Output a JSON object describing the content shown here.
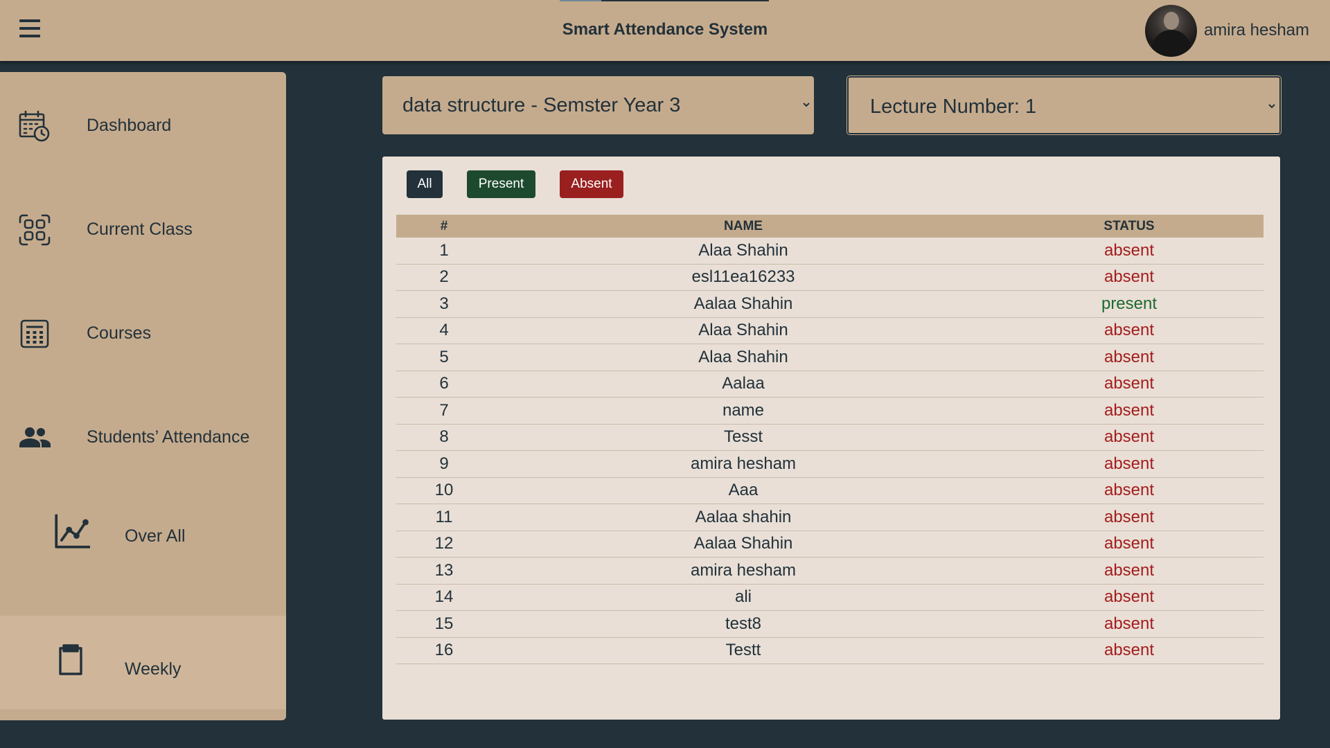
{
  "header": {
    "title": "Smart Attendance System",
    "user_name": "amira hesham"
  },
  "sidebar": {
    "items": [
      {
        "label": "Dashboard",
        "icon": "calendar-clock-icon"
      },
      {
        "label": "Current Class",
        "icon": "qr-scan-icon"
      },
      {
        "label": "Courses",
        "icon": "calculator-icon"
      },
      {
        "label": "Students’ Attendance",
        "icon": "people-icon"
      },
      {
        "label": "Over All",
        "icon": "line-chart-icon"
      },
      {
        "label": "Weekly",
        "icon": "clipboard-icon"
      }
    ]
  },
  "filters": {
    "course": "data structure - Semster Year 3",
    "lecture": "Lecture Number: 1"
  },
  "buttons": {
    "all": "All",
    "present": "Present",
    "absent": "Absent"
  },
  "table": {
    "headers": [
      "#",
      "NAME",
      "STATUS"
    ],
    "rows": [
      {
        "num": "1",
        "name": "Alaa Shahin",
        "status": "absent"
      },
      {
        "num": "2",
        "name": "esl11ea16233",
        "status": "absent"
      },
      {
        "num": "3",
        "name": "Aalaa Shahin",
        "status": "present"
      },
      {
        "num": "4",
        "name": "Alaa Shahin",
        "status": "absent"
      },
      {
        "num": "5",
        "name": "Alaa Shahin",
        "status": "absent"
      },
      {
        "num": "6",
        "name": "Aalaa",
        "status": "absent"
      },
      {
        "num": "7",
        "name": "name",
        "status": "absent"
      },
      {
        "num": "8",
        "name": "Tesst",
        "status": "absent"
      },
      {
        "num": "9",
        "name": "amira hesham",
        "status": "absent"
      },
      {
        "num": "10",
        "name": "Aaa",
        "status": "absent"
      },
      {
        "num": "11",
        "name": "Aalaa shahin",
        "status": "absent"
      },
      {
        "num": "12",
        "name": "Aalaa Shahin",
        "status": "absent"
      },
      {
        "num": "13",
        "name": "amira hesham",
        "status": "absent"
      },
      {
        "num": "14",
        "name": "ali",
        "status": "absent"
      },
      {
        "num": "15",
        "name": "test8",
        "status": "absent"
      },
      {
        "num": "16",
        "name": "Testt",
        "status": "absent"
      }
    ]
  },
  "colors": {
    "background": "#22313a",
    "surface": "#c5ab8d",
    "panel": "#e9dfd6",
    "present": "#1c6a2e",
    "absent": "#a31d1d"
  }
}
